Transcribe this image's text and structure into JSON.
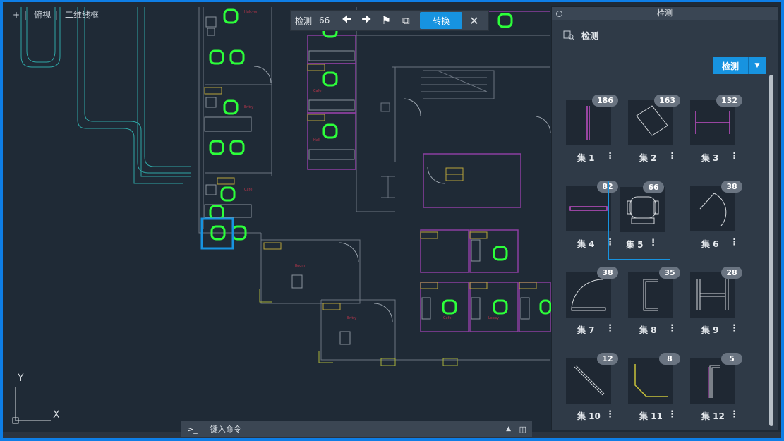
{
  "viewport": {
    "controls": [
      "+",
      "俯视",
      "二维线框"
    ],
    "ucs": {
      "x_label": "X",
      "y_label": "Y"
    },
    "room_tag": "NUMBER"
  },
  "detect_toolbar": {
    "label": "检测",
    "count": "66",
    "convert_label": "转换",
    "icons": [
      "arrow-left-icon",
      "arrow-right-icon",
      "flag-icon",
      "layers-icon",
      "close-icon"
    ]
  },
  "panel": {
    "title": "检测",
    "header_label": "检测",
    "detect_button": "检测",
    "sets": [
      {
        "name": "集 1",
        "count": "186"
      },
      {
        "name": "集 2",
        "count": "163"
      },
      {
        "name": "集 3",
        "count": "132"
      },
      {
        "name": "集 4",
        "count": "82"
      },
      {
        "name": "集 5",
        "count": "66"
      },
      {
        "name": "集 6",
        "count": "38"
      },
      {
        "name": "集 7",
        "count": "38"
      },
      {
        "name": "集 8",
        "count": "35"
      },
      {
        "name": "集 9",
        "count": "28"
      },
      {
        "name": "集 10",
        "count": "12"
      },
      {
        "name": "集 11",
        "count": "8"
      },
      {
        "name": "集 12",
        "count": "5"
      }
    ],
    "selected_set": "集 5"
  },
  "command_line": {
    "prompt": ">_",
    "placeholder": "键入命令"
  },
  "colors": {
    "accent": "#1793e0",
    "highlight": "#2cff3a",
    "walls": "#8c3ea0",
    "background": "#1f2a36"
  }
}
